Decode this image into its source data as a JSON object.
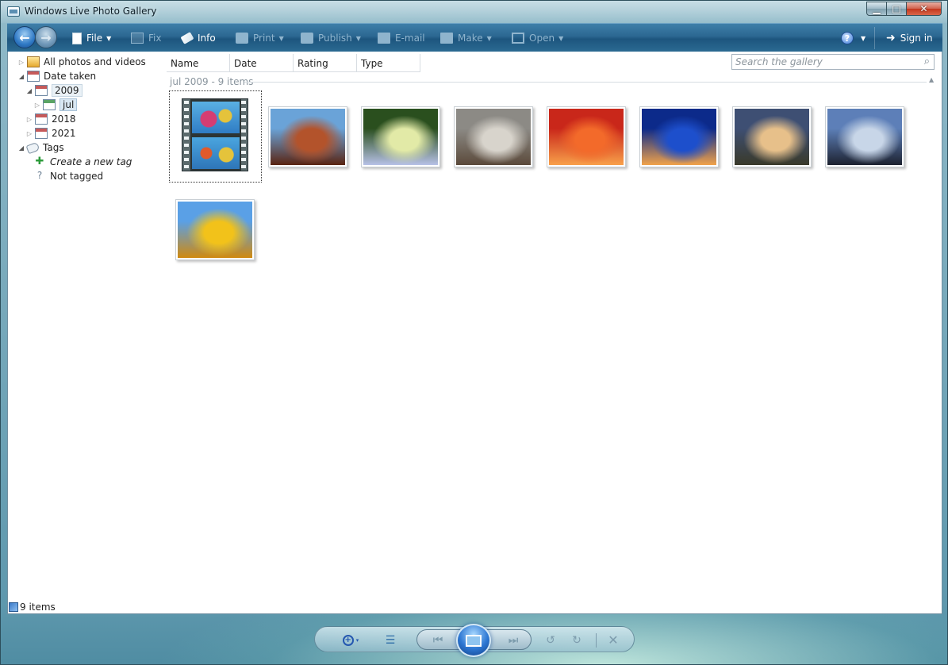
{
  "window": {
    "title": "Windows Live Photo Gallery",
    "minimize_glyph": "▁",
    "maximize_glyph": "□",
    "close_glyph": "✕"
  },
  "toolbar": {
    "file": "File",
    "fix": "Fix",
    "info": "Info",
    "print": "Print",
    "publish": "Publish",
    "email": "E-mail",
    "make": "Make",
    "open": "Open",
    "help_glyph": "?",
    "sign_in": "Sign in"
  },
  "tree": {
    "all_photos": "All photos and videos",
    "date_taken": "Date taken",
    "year_2009": "2009",
    "month_jul": "jul",
    "year_2018": "2018",
    "year_2021": "2021",
    "tags": "Tags",
    "create_tag": "Create a new tag",
    "not_tagged": "Not tagged"
  },
  "columns": {
    "name": "Name",
    "date": "Date",
    "rating": "Rating",
    "type": "Type"
  },
  "search": {
    "placeholder": "Search the gallery"
  },
  "group": {
    "label": "jul 2009 - 9 items"
  },
  "thumbnails": [
    {
      "kind": "video",
      "subject": "hot-air-balloons-video"
    },
    {
      "kind": "photo",
      "subject": "desert-mesa",
      "colors": [
        "#6aa3d8",
        "#b3532b",
        "#5a2412"
      ]
    },
    {
      "kind": "photo",
      "subject": "hydrangea",
      "colors": [
        "#2a4f1e",
        "#e2eaa7",
        "#b7c1e6"
      ]
    },
    {
      "kind": "photo",
      "subject": "koala",
      "colors": [
        "#8c8a85",
        "#d8d4cc",
        "#5b4a3b"
      ]
    },
    {
      "kind": "photo",
      "subject": "chrysanthemum",
      "colors": [
        "#c9271a",
        "#f36a2a",
        "#f8a04a"
      ]
    },
    {
      "kind": "photo",
      "subject": "jellyfish",
      "colors": [
        "#0c2a8a",
        "#1d4fcc",
        "#f0a24a"
      ]
    },
    {
      "kind": "photo",
      "subject": "lighthouse",
      "colors": [
        "#3e4f73",
        "#e7c08a",
        "#3a3a2a"
      ]
    },
    {
      "kind": "photo",
      "subject": "penguins",
      "colors": [
        "#5d7fb8",
        "#c8d6e8",
        "#1d2230"
      ]
    },
    {
      "kind": "photo",
      "subject": "tulips",
      "colors": [
        "#5aa0e6",
        "#f2c21a",
        "#d08a10"
      ]
    }
  ],
  "status": {
    "count": "9 items"
  },
  "controls": {
    "zoom_plus": "+",
    "zoom_dropdown": "▾",
    "details": "☰",
    "prev": "⏮",
    "next": "⏭",
    "rotate_left": "↺",
    "rotate_right": "↻",
    "delete": "✕"
  }
}
